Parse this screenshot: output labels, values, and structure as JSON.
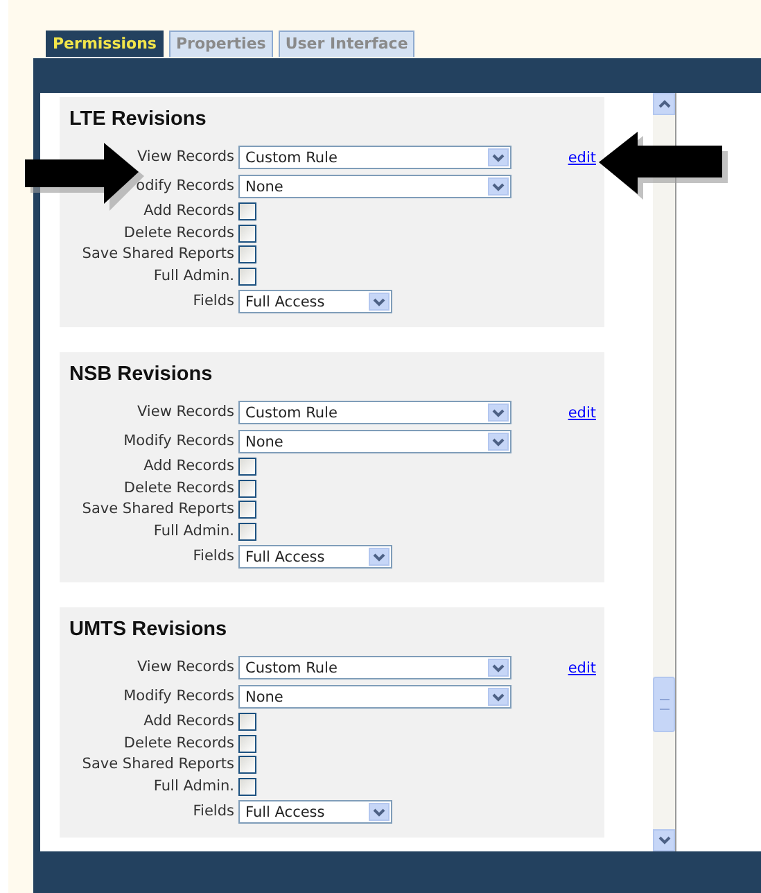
{
  "tabs": [
    {
      "label": "Permissions",
      "selected": true
    },
    {
      "label": "Properties",
      "selected": false
    },
    {
      "label": "User Interface",
      "selected": false
    }
  ],
  "sections": [
    {
      "title": "LTE Revisions",
      "edit": "edit",
      "rows": [
        {
          "kind": "select",
          "label": "View Records",
          "value": "Custom Rule"
        },
        {
          "kind": "select",
          "label": "odify Records",
          "value": "None"
        },
        {
          "kind": "checkbox",
          "label": "Add Records",
          "checked": false
        },
        {
          "kind": "checkbox",
          "label": "Delete Records",
          "checked": false
        },
        {
          "kind": "checkbox",
          "label": "Save Shared Reports",
          "checked": false
        },
        {
          "kind": "checkbox",
          "label": "Full Admin.",
          "checked": false
        },
        {
          "kind": "select",
          "label": "Fields",
          "value": "Full Access"
        }
      ]
    },
    {
      "title": "NSB Revisions",
      "edit": "edit",
      "rows": [
        {
          "kind": "select",
          "label": "View Records",
          "value": "Custom Rule"
        },
        {
          "kind": "select",
          "label": "Modify Records",
          "value": "None"
        },
        {
          "kind": "checkbox",
          "label": "Add Records",
          "checked": false
        },
        {
          "kind": "checkbox",
          "label": "Delete Records",
          "checked": false
        },
        {
          "kind": "checkbox",
          "label": "Save Shared Reports",
          "checked": false
        },
        {
          "kind": "checkbox",
          "label": "Full Admin.",
          "checked": false
        },
        {
          "kind": "select",
          "label": "Fields",
          "value": "Full Access"
        }
      ]
    },
    {
      "title": "UMTS Revisions",
      "edit": "edit",
      "rows": [
        {
          "kind": "select",
          "label": "View Records",
          "value": "Custom Rule"
        },
        {
          "kind": "select",
          "label": "Modify Records",
          "value": "None"
        },
        {
          "kind": "checkbox",
          "label": "Add Records",
          "checked": false
        },
        {
          "kind": "checkbox",
          "label": "Delete Records",
          "checked": false
        },
        {
          "kind": "checkbox",
          "label": "Save Shared Reports",
          "checked": false
        },
        {
          "kind": "checkbox",
          "label": "Full Admin.",
          "checked": false
        },
        {
          "kind": "select",
          "label": "Fields",
          "value": "Full Access"
        }
      ]
    }
  ]
}
